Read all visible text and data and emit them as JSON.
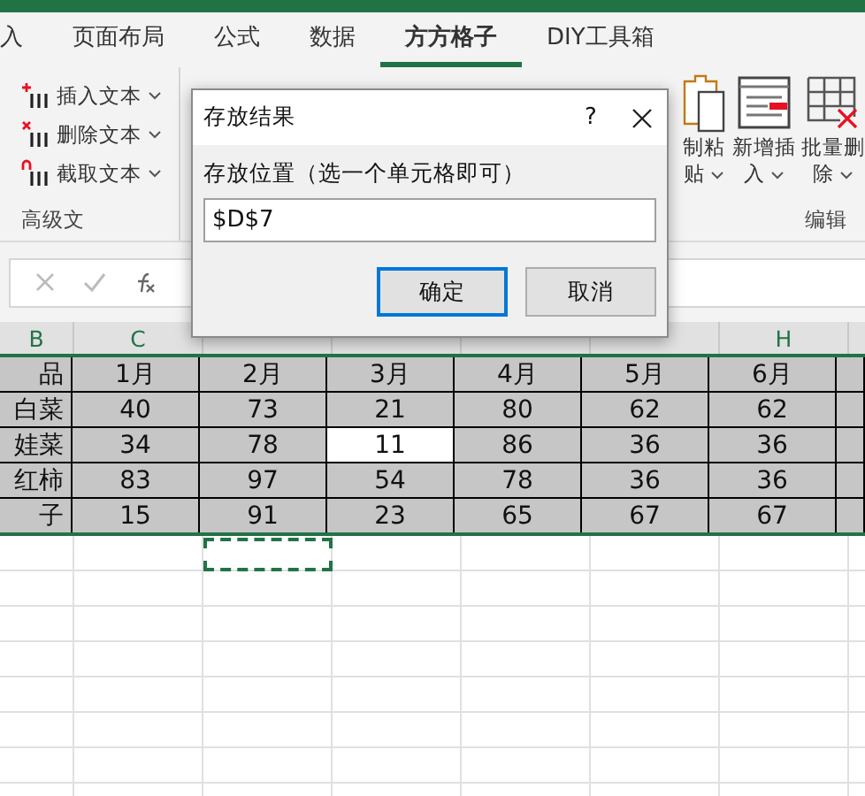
{
  "tabs": [
    {
      "label": "入",
      "selected": false
    },
    {
      "label": "页面布局",
      "selected": false
    },
    {
      "label": "公式",
      "selected": false
    },
    {
      "label": "数据",
      "selected": false
    },
    {
      "label": "方方格子",
      "selected": true
    },
    {
      "label": "DIY工具箱",
      "selected": false
    }
  ],
  "ribbon": {
    "left_group": {
      "label": "高级文",
      "buttons": [
        {
          "kind": "insert",
          "label": "插入文本"
        },
        {
          "kind": "delete",
          "label": "删除文本"
        },
        {
          "kind": "extract",
          "label": "截取文本"
        }
      ]
    },
    "right_group": {
      "label": "编辑",
      "buttons": [
        {
          "kind": "paste",
          "lines": [
            "制粘",
            "贴"
          ]
        },
        {
          "kind": "add-rows",
          "lines": [
            "新增插",
            "入"
          ]
        },
        {
          "kind": "delete-rows",
          "lines": [
            "批量删",
            "除"
          ]
        }
      ]
    }
  },
  "dialog": {
    "title": "存放结果",
    "help": "?",
    "field_label": "存放位置（选一个单元格即可）",
    "value": "$D$7",
    "buttons": [
      {
        "label": "确定",
        "selected": true
      },
      {
        "label": "取消",
        "selected": false
      }
    ]
  },
  "sheet": {
    "columns_left": [
      "B",
      "C"
    ],
    "columns_right": [
      "H"
    ],
    "rows": [
      {
        "cells": [
          {
            "text": "品",
            "active": false
          },
          {
            "text": "1月",
            "active": false
          },
          {
            "text": "2月",
            "active": false
          },
          {
            "text": "3月",
            "active": false
          },
          {
            "text": "4月",
            "active": false
          },
          {
            "text": "5月",
            "active": false
          },
          {
            "text": "6月",
            "active": false
          }
        ]
      },
      {
        "cells": [
          {
            "text": "白菜",
            "active": false
          },
          {
            "text": "40",
            "active": false
          },
          {
            "text": "73",
            "active": false
          },
          {
            "text": "21",
            "active": false
          },
          {
            "text": "80",
            "active": false
          },
          {
            "text": "62",
            "active": false
          },
          {
            "text": "62",
            "active": false
          }
        ]
      },
      {
        "cells": [
          {
            "text": "娃菜",
            "active": false
          },
          {
            "text": "34",
            "active": false
          },
          {
            "text": "78",
            "active": false
          },
          {
            "text": "11",
            "active": true
          },
          {
            "text": "86",
            "active": false
          },
          {
            "text": "36",
            "active": false
          },
          {
            "text": "36",
            "active": false
          }
        ]
      },
      {
        "cells": [
          {
            "text": "红柿",
            "active": false
          },
          {
            "text": "83",
            "active": false
          },
          {
            "text": "97",
            "active": false
          },
          {
            "text": "54",
            "active": false
          },
          {
            "text": "78",
            "active": false
          },
          {
            "text": "36",
            "active": false
          },
          {
            "text": "36",
            "active": false
          }
        ]
      },
      {
        "cells": [
          {
            "text": "子",
            "active": false
          },
          {
            "text": "15",
            "active": false
          },
          {
            "text": "91",
            "active": false
          },
          {
            "text": "23",
            "active": false
          },
          {
            "text": "65",
            "active": false
          },
          {
            "text": "67",
            "active": false
          },
          {
            "text": "67",
            "active": false
          }
        ]
      }
    ]
  }
}
